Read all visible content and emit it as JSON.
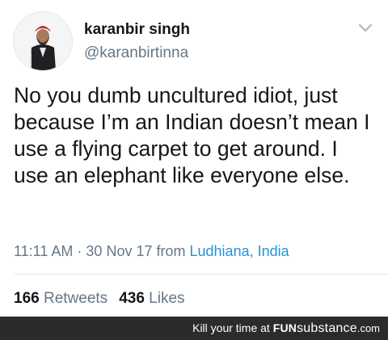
{
  "tweet": {
    "author_name": "karanbir singh",
    "author_handle": "@karanbirtinna",
    "text": "No you dumb uncultured idiot, just because I’m an Indian doesn’t mean I use a flying carpet to get around. I use an elephant like everyone else.",
    "time": "11:11 AM",
    "separator": "·",
    "date": "30 Nov 17",
    "from_label": "from",
    "location": "Ludhiana, India",
    "retweets_count": "166",
    "retweets_label": "Retweets",
    "likes_count": "436",
    "likes_label": "Likes"
  },
  "footer": {
    "tagline": "Kill your time at",
    "brand_fun": "FUN",
    "brand_substance": "substance",
    "brand_com": ".com"
  },
  "icons": {
    "menu": "chevron-down-icon",
    "avatar": "avatar-photo"
  },
  "colors": {
    "text": "#14171a",
    "secondary": "#657786",
    "link": "#1b95e0",
    "footer_bg": "#2b2b2b"
  }
}
